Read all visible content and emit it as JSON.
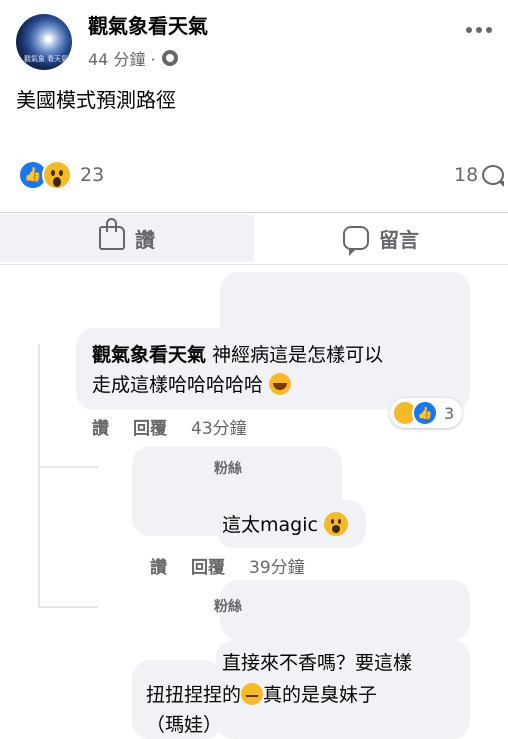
{
  "post": {
    "page_name": "觀氣象看天氣",
    "avatar_text": "觀氣象 看天氣",
    "time": "44 分鐘 ·",
    "text": "美國模式預測路徑",
    "reaction_count": "23",
    "comment_count": "18"
  },
  "actions": {
    "like_label": "讚",
    "comment_label": "留言"
  },
  "comments": [
    {
      "author": "觀氣象看天氣",
      "text_line1": "神經病這是怎樣可以",
      "text_line2": "走成這樣哈哈哈哈哈",
      "like_label": "讚",
      "reply_label": "回覆",
      "time": "43分鐘",
      "reaction_count": "3"
    },
    {
      "author_partial": "粉絲",
      "text": "這太magic",
      "like_label": "讚",
      "reply_label": "回覆",
      "time": "39分鐘"
    },
    {
      "author_partial": "粉絲",
      "text_line1": "直接來不香嗎？要這樣",
      "text_line2_a": "扭扭捏捏的",
      "text_line2_b": "真的是臭妹子",
      "text_line3": "（瑪娃）"
    }
  ],
  "colors": {
    "brand_blue": "#1877f2",
    "reaction_yellow": "#f7b928",
    "secondary_text": "#65676b",
    "bubble_bg": "#f0f2f5"
  }
}
